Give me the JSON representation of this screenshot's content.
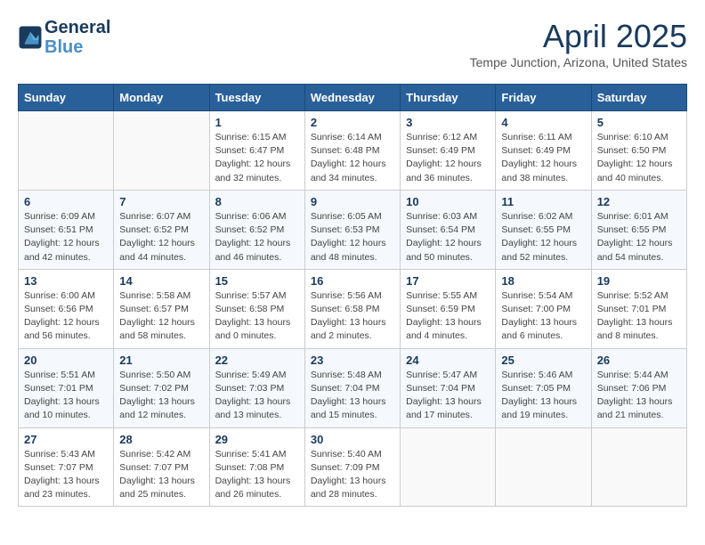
{
  "header": {
    "logo_line1": "General",
    "logo_line2": "Blue",
    "month_title": "April 2025",
    "location": "Tempe Junction, Arizona, United States"
  },
  "weekdays": [
    "Sunday",
    "Monday",
    "Tuesday",
    "Wednesday",
    "Thursday",
    "Friday",
    "Saturday"
  ],
  "weeks": [
    [
      {
        "day": "",
        "info": ""
      },
      {
        "day": "",
        "info": ""
      },
      {
        "day": "1",
        "info": "Sunrise: 6:15 AM\nSunset: 6:47 PM\nDaylight: 12 hours\nand 32 minutes."
      },
      {
        "day": "2",
        "info": "Sunrise: 6:14 AM\nSunset: 6:48 PM\nDaylight: 12 hours\nand 34 minutes."
      },
      {
        "day": "3",
        "info": "Sunrise: 6:12 AM\nSunset: 6:49 PM\nDaylight: 12 hours\nand 36 minutes."
      },
      {
        "day": "4",
        "info": "Sunrise: 6:11 AM\nSunset: 6:49 PM\nDaylight: 12 hours\nand 38 minutes."
      },
      {
        "day": "5",
        "info": "Sunrise: 6:10 AM\nSunset: 6:50 PM\nDaylight: 12 hours\nand 40 minutes."
      }
    ],
    [
      {
        "day": "6",
        "info": "Sunrise: 6:09 AM\nSunset: 6:51 PM\nDaylight: 12 hours\nand 42 minutes."
      },
      {
        "day": "7",
        "info": "Sunrise: 6:07 AM\nSunset: 6:52 PM\nDaylight: 12 hours\nand 44 minutes."
      },
      {
        "day": "8",
        "info": "Sunrise: 6:06 AM\nSunset: 6:52 PM\nDaylight: 12 hours\nand 46 minutes."
      },
      {
        "day": "9",
        "info": "Sunrise: 6:05 AM\nSunset: 6:53 PM\nDaylight: 12 hours\nand 48 minutes."
      },
      {
        "day": "10",
        "info": "Sunrise: 6:03 AM\nSunset: 6:54 PM\nDaylight: 12 hours\nand 50 minutes."
      },
      {
        "day": "11",
        "info": "Sunrise: 6:02 AM\nSunset: 6:55 PM\nDaylight: 12 hours\nand 52 minutes."
      },
      {
        "day": "12",
        "info": "Sunrise: 6:01 AM\nSunset: 6:55 PM\nDaylight: 12 hours\nand 54 minutes."
      }
    ],
    [
      {
        "day": "13",
        "info": "Sunrise: 6:00 AM\nSunset: 6:56 PM\nDaylight: 12 hours\nand 56 minutes."
      },
      {
        "day": "14",
        "info": "Sunrise: 5:58 AM\nSunset: 6:57 PM\nDaylight: 12 hours\nand 58 minutes."
      },
      {
        "day": "15",
        "info": "Sunrise: 5:57 AM\nSunset: 6:58 PM\nDaylight: 13 hours\nand 0 minutes."
      },
      {
        "day": "16",
        "info": "Sunrise: 5:56 AM\nSunset: 6:58 PM\nDaylight: 13 hours\nand 2 minutes."
      },
      {
        "day": "17",
        "info": "Sunrise: 5:55 AM\nSunset: 6:59 PM\nDaylight: 13 hours\nand 4 minutes."
      },
      {
        "day": "18",
        "info": "Sunrise: 5:54 AM\nSunset: 7:00 PM\nDaylight: 13 hours\nand 6 minutes."
      },
      {
        "day": "19",
        "info": "Sunrise: 5:52 AM\nSunset: 7:01 PM\nDaylight: 13 hours\nand 8 minutes."
      }
    ],
    [
      {
        "day": "20",
        "info": "Sunrise: 5:51 AM\nSunset: 7:01 PM\nDaylight: 13 hours\nand 10 minutes."
      },
      {
        "day": "21",
        "info": "Sunrise: 5:50 AM\nSunset: 7:02 PM\nDaylight: 13 hours\nand 12 minutes."
      },
      {
        "day": "22",
        "info": "Sunrise: 5:49 AM\nSunset: 7:03 PM\nDaylight: 13 hours\nand 13 minutes."
      },
      {
        "day": "23",
        "info": "Sunrise: 5:48 AM\nSunset: 7:04 PM\nDaylight: 13 hours\nand 15 minutes."
      },
      {
        "day": "24",
        "info": "Sunrise: 5:47 AM\nSunset: 7:04 PM\nDaylight: 13 hours\nand 17 minutes."
      },
      {
        "day": "25",
        "info": "Sunrise: 5:46 AM\nSunset: 7:05 PM\nDaylight: 13 hours\nand 19 minutes."
      },
      {
        "day": "26",
        "info": "Sunrise: 5:44 AM\nSunset: 7:06 PM\nDaylight: 13 hours\nand 21 minutes."
      }
    ],
    [
      {
        "day": "27",
        "info": "Sunrise: 5:43 AM\nSunset: 7:07 PM\nDaylight: 13 hours\nand 23 minutes."
      },
      {
        "day": "28",
        "info": "Sunrise: 5:42 AM\nSunset: 7:07 PM\nDaylight: 13 hours\nand 25 minutes."
      },
      {
        "day": "29",
        "info": "Sunrise: 5:41 AM\nSunset: 7:08 PM\nDaylight: 13 hours\nand 26 minutes."
      },
      {
        "day": "30",
        "info": "Sunrise: 5:40 AM\nSunset: 7:09 PM\nDaylight: 13 hours\nand 28 minutes."
      },
      {
        "day": "",
        "info": ""
      },
      {
        "day": "",
        "info": ""
      },
      {
        "day": "",
        "info": ""
      }
    ]
  ]
}
